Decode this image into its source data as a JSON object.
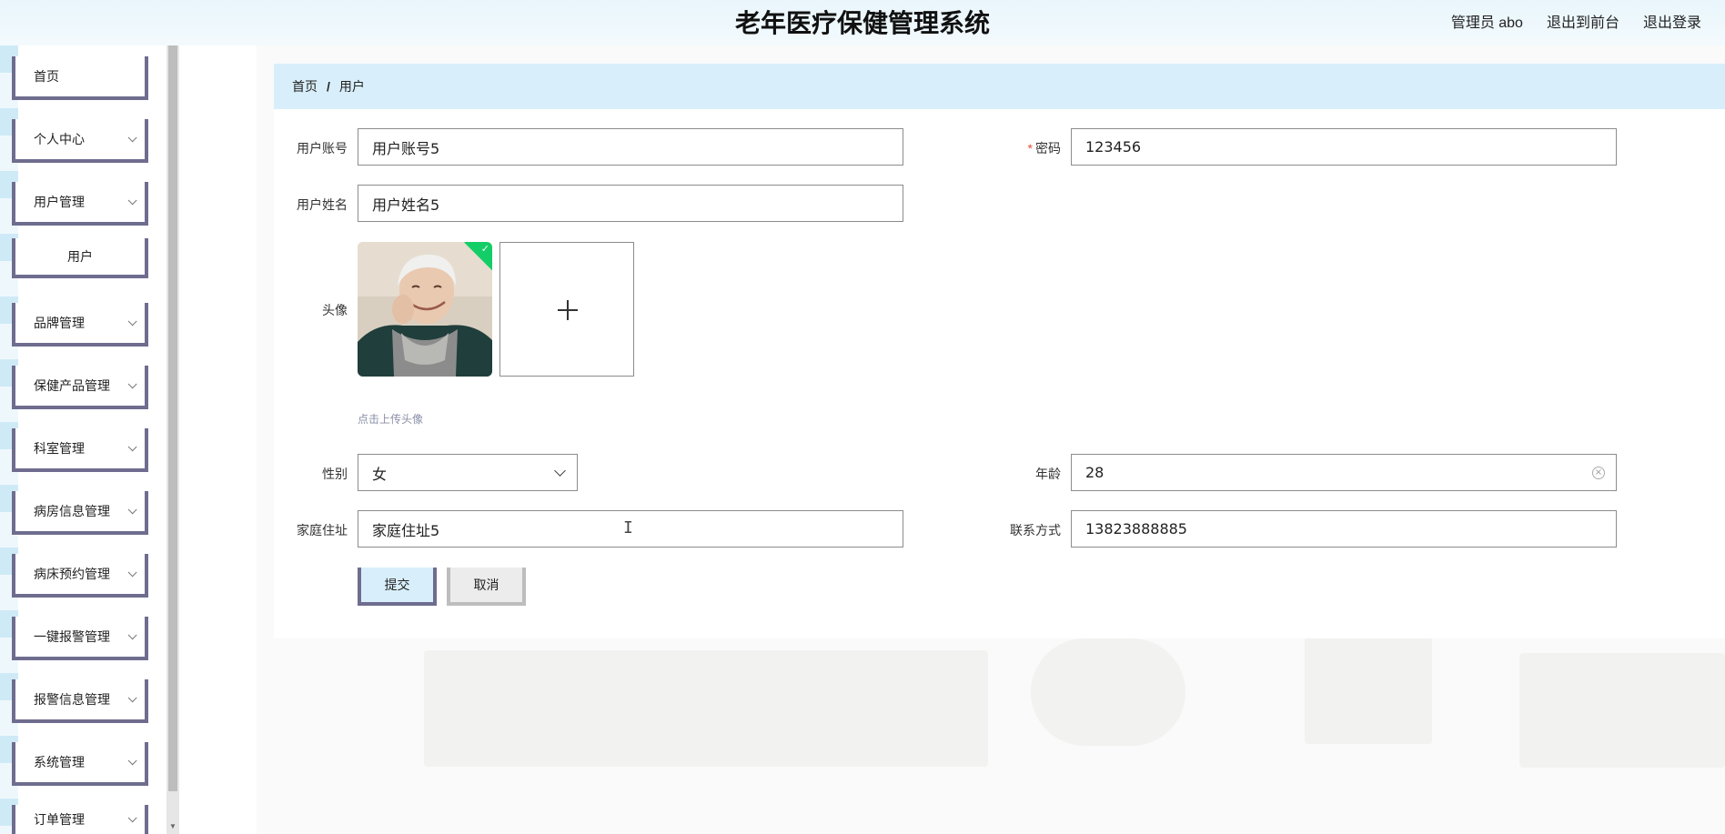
{
  "header": {
    "title": "老年医疗保健管理系统",
    "user_label": "管理员 abo",
    "front_link": "退出到前台",
    "logout_link": "退出登录"
  },
  "sidebar": {
    "items": [
      {
        "label": "首页"
      },
      {
        "label": "个人中心"
      },
      {
        "label": "用户管理"
      },
      {
        "label": "用户"
      },
      {
        "label": "品牌管理"
      },
      {
        "label": "保健产品管理"
      },
      {
        "label": "科室管理"
      },
      {
        "label": "病房信息管理"
      },
      {
        "label": "病床预约管理"
      },
      {
        "label": "一键报警管理"
      },
      {
        "label": "报警信息管理"
      },
      {
        "label": "系统管理"
      },
      {
        "label": "订单管理"
      }
    ]
  },
  "breadcrumb": {
    "home": "首页",
    "separator": "/",
    "current": "用户"
  },
  "form": {
    "account_label": "用户账号",
    "account_value": "用户账号5",
    "password_label": "密码",
    "password_required": "*",
    "password_value": "123456",
    "name_label": "用户姓名",
    "name_value": "用户姓名5",
    "avatar_label": "头像",
    "avatar_tip": "点击上传头像",
    "gender_label": "性别",
    "gender_value": "女",
    "age_label": "年龄",
    "age_value": "28",
    "address_label": "家庭住址",
    "address_value": "家庭住址5",
    "phone_label": "联系方式",
    "phone_value": "13823888885",
    "submit_label": "提交",
    "cancel_label": "取消"
  },
  "colors": {
    "header_bg": "#e9f6fc",
    "breadcrumb_bg": "#d8effb",
    "nav_border": "#6e6d8f",
    "success_badge": "#13ce66",
    "required_star": "#e0503c"
  }
}
